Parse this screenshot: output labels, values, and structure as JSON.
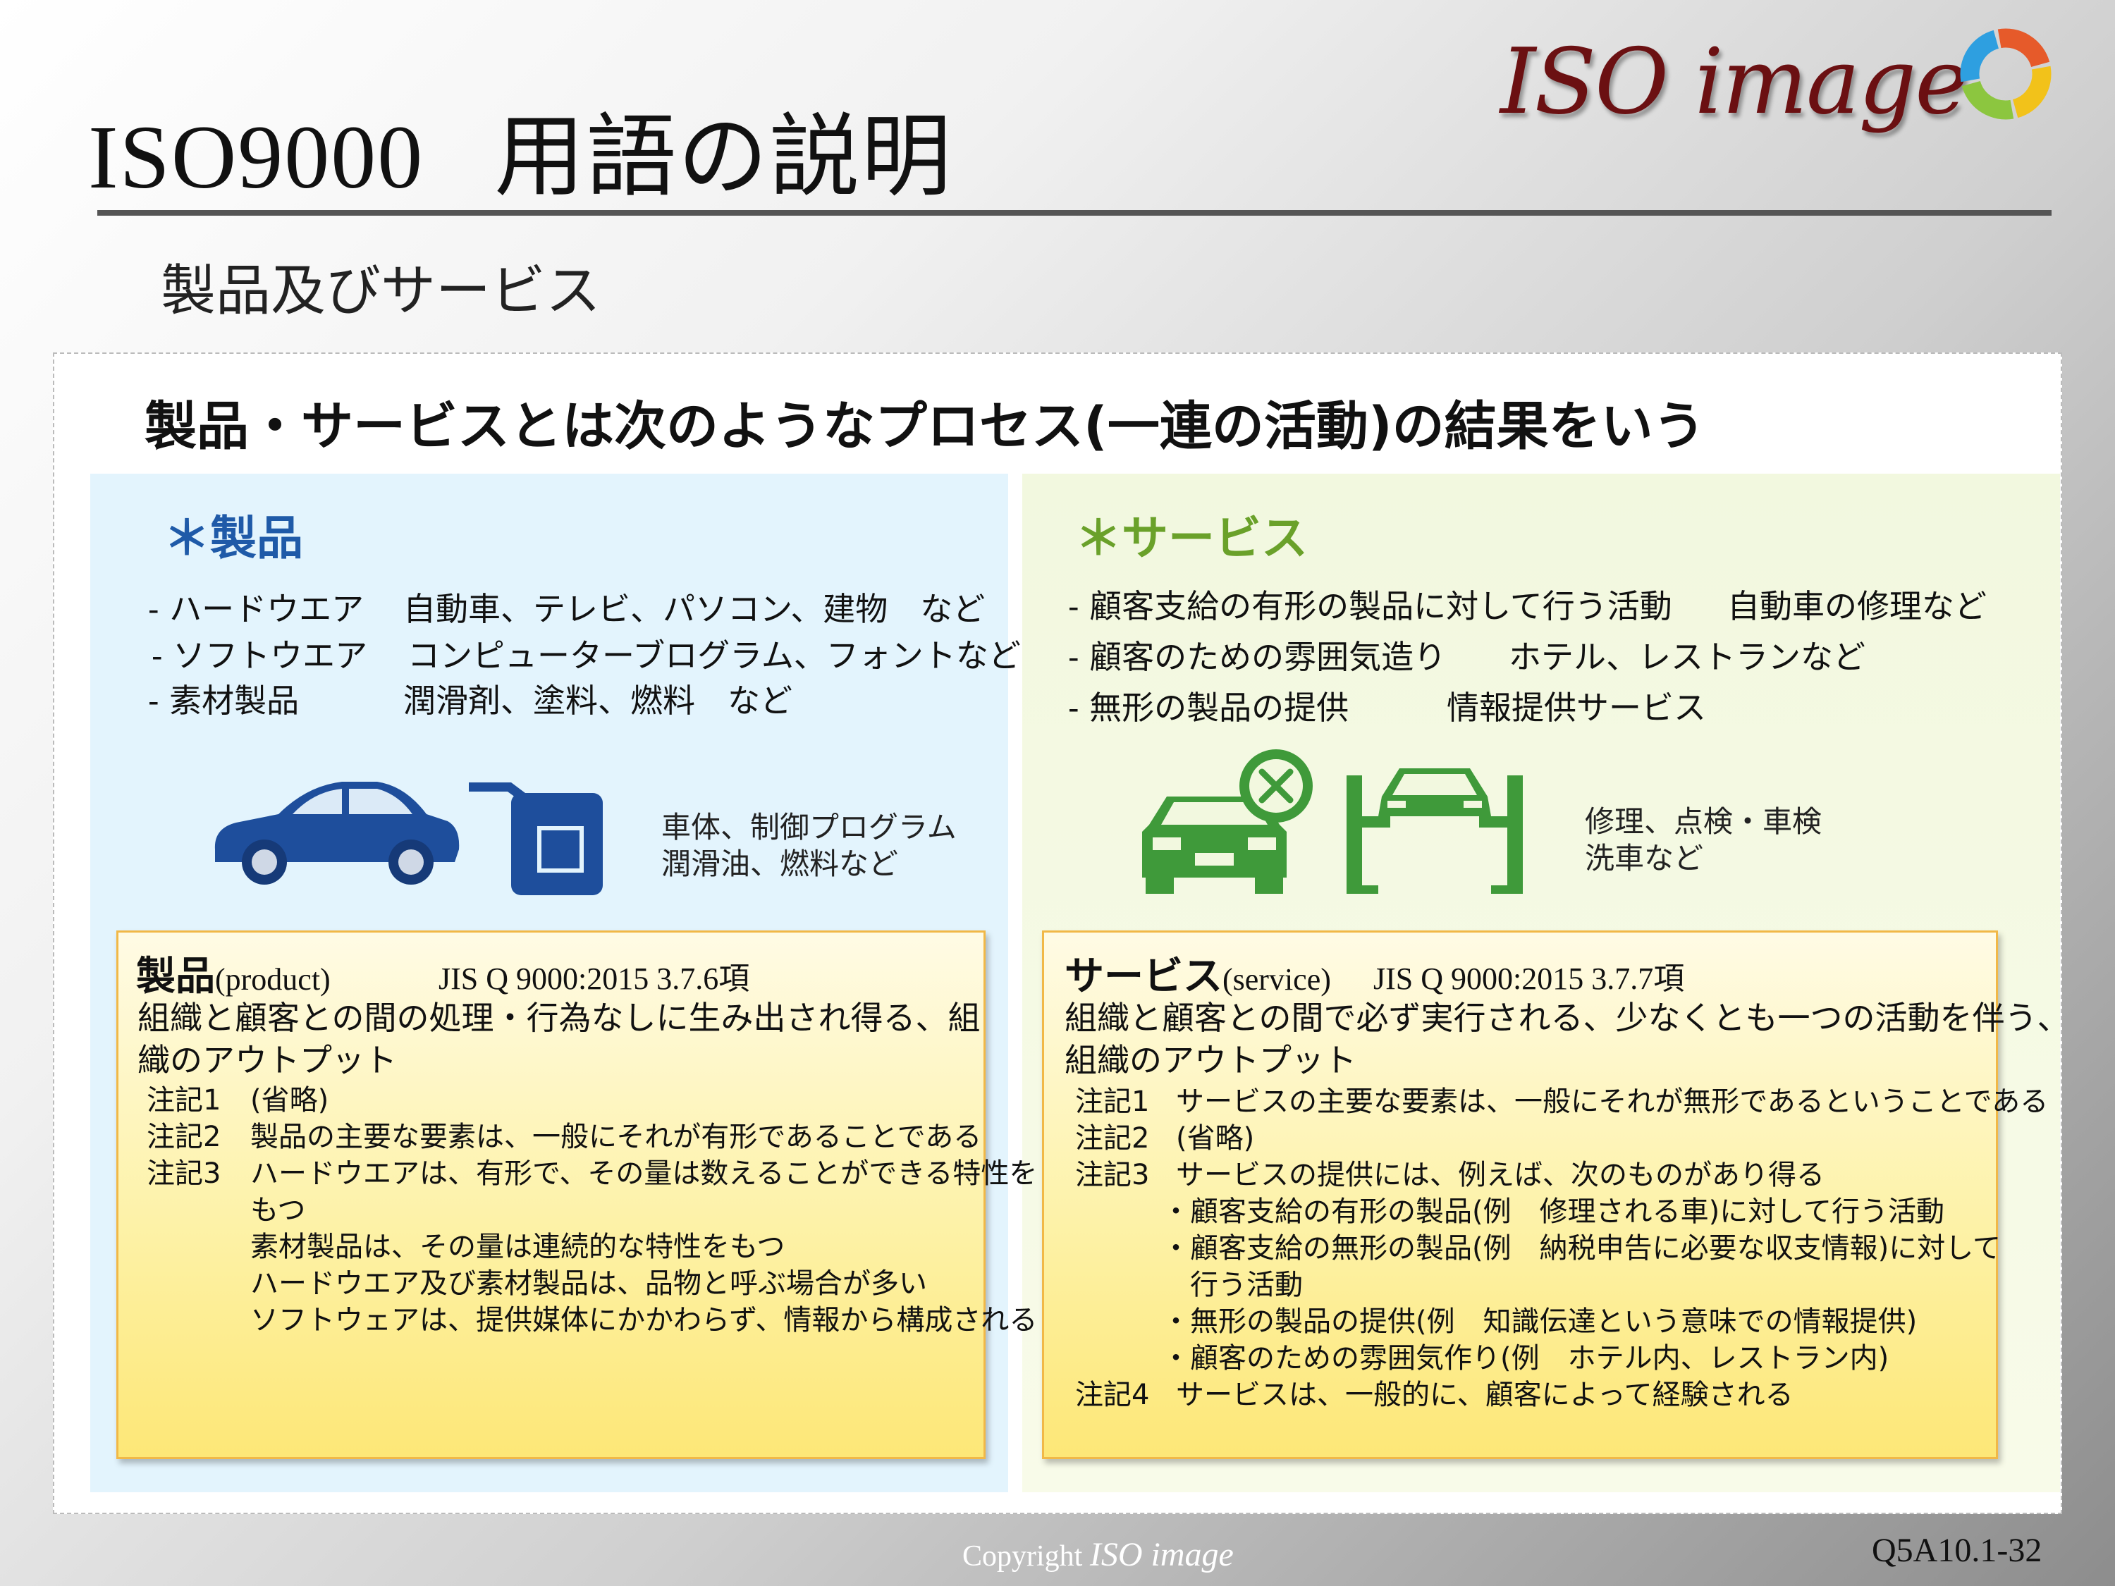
{
  "header": {
    "title_en": "ISO9000",
    "title_jp": "用語の説明",
    "logo_text": "ISO image",
    "subtitle": "製品及びサービス"
  },
  "headline": "製品・サービスとは次のようなプロセス(一連の活動)の結果をいう",
  "product": {
    "heading": "＊製品",
    "items": [
      {
        "label": "- ハードウエア",
        "examples": "自動車、テレビ、パソコン、建物　など"
      },
      {
        "label": "- ソフトウエア",
        "examples": "コンピューターブログラム、フォントなど"
      },
      {
        "label": "- 素材製品",
        "examples": "潤滑剤、塗料、燃料　など"
      }
    ],
    "caption": [
      "車体、制御プログラム",
      "潤滑油、燃料など"
    ],
    "definition": {
      "term": "製品",
      "term_en": "(product)",
      "reference": "JIS Q 9000:2015 3.7.6項",
      "text": [
        "組織と顧客との間の処理・行為なしに生み出され得る、組",
        "織のアウトプット"
      ],
      "notes": [
        {
          "label": "注記1",
          "text": "(省略)"
        },
        {
          "label": "注記2",
          "text": "製品の主要な要素は、一般にそれが有形であることである"
        },
        {
          "label": "注記3",
          "text": "ハードウエアは、有形で、その量は数えることができる特性を"
        },
        {
          "label": "",
          "text": "もつ"
        },
        {
          "label": "",
          "text": "素材製品は、その量は連続的な特性をもつ"
        },
        {
          "label": "",
          "text": "ハードウエア及び素材製品は、品物と呼ぶ場合が多い"
        },
        {
          "label": "",
          "text": "ソフトウェアは、提供媒体にかかわらず、情報から構成される"
        }
      ]
    }
  },
  "service": {
    "heading": "＊サービス",
    "items": [
      {
        "label": "- 顧客支給の有形の製品に対して行う活動",
        "examples": "自動車の修理など"
      },
      {
        "label": "- 顧客のための雰囲気造り",
        "examples": "ホテル、レストランなど"
      },
      {
        "label": "- 無形の製品の提供",
        "examples": "情報提供サービス"
      }
    ],
    "caption": [
      "修理、点検・車検",
      "洗車など"
    ],
    "definition": {
      "term": "サービス",
      "term_en": "(service)",
      "reference": "JIS Q 9000:2015 3.7.7項",
      "text": [
        "組織と顧客との間で必ず実行される、少なくとも一つの活動を伴う、",
        "組織のアウトプット"
      ],
      "notes": [
        {
          "label": "注記1",
          "text": "サービスの主要な要素は、一般にそれが無形であるということである"
        },
        {
          "label": "注記2",
          "text": "(省略)"
        },
        {
          "label": "注記3",
          "text": "サービスの提供には、例えば、次のものがあり得る"
        },
        {
          "label": "",
          "text": "・顧客支給の有形の製品(例　修理される車)に対して行う活動"
        },
        {
          "label": "",
          "text": "・顧客支給の無形の製品(例　納税申告に必要な収支情報)に対して"
        },
        {
          "label": "",
          "text": "　行う活動"
        },
        {
          "label": "",
          "text": "・無形の製品の提供(例　知識伝達という意味での情報提供)"
        },
        {
          "label": "",
          "text": "・顧客のための雰囲気作り(例　ホテル内、レストラン内)"
        },
        {
          "label": "注記4",
          "text": "サービスは、一般的に、顧客によって経験される"
        }
      ]
    }
  },
  "footer": {
    "copyright": "Copyright",
    "logo": "ISO image",
    "page_code": "Q5A10.1-32"
  },
  "colors": {
    "product_blue": "#1f5aa8",
    "service_green": "#4b9e3a",
    "logo_red": "#6b1012"
  }
}
